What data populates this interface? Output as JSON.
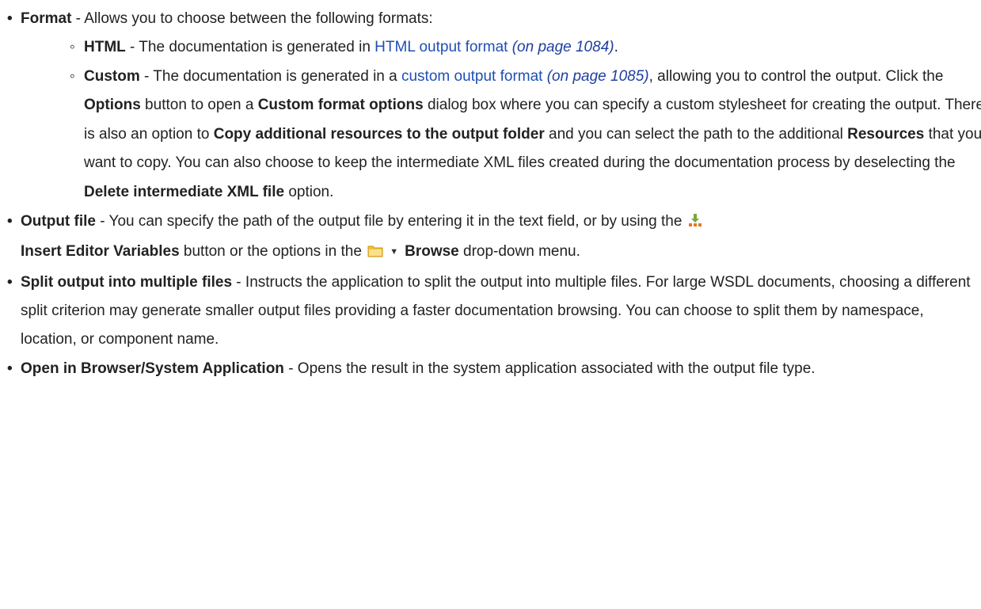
{
  "items": {
    "format": {
      "term": "Format",
      "text": " - Allows you to choose between the following formats:",
      "html": {
        "term": "HTML",
        "text": " - The documentation is generated in ",
        "link": "HTML output format",
        "ref": "(on page 1084)",
        "end": "."
      },
      "custom": {
        "term": "Custom",
        "text1": " - The documentation is generated in a ",
        "link": "custom output format",
        "ref": "(on page 1085)",
        "text2": ", allowing you to control the output. Click the ",
        "options": "Options",
        "text3": " button to open a ",
        "dialog": "Custom format options",
        "text4": " dialog box where you can specify a custom stylesheet for creating the output. There is also an option to ",
        "copy": "Copy additional resources to the output folder",
        "text5": " and you can select the path to the additional ",
        "resources": "Resources",
        "text6": " that you want to copy. You can also choose to keep the intermediate XML files created during the documentation process by deselecting the ",
        "delete": "Delete intermediate XML file",
        "text7": " option."
      }
    },
    "output_file": {
      "term": "Output file",
      "text1": " - You can specify the path of the output file by entering it in the text field, or by using the ",
      "insert": "Insert Editor Variables",
      "text2": " button or the options in the ",
      "browse": "Browse",
      "text3": " drop-down menu."
    },
    "split": {
      "term": "Split output into multiple files",
      "text": " - Instructs the application to split the output into multiple files. For large WSDL documents, choosing a different split criterion may generate smaller output files providing a faster documentation browsing. You can choose to split them by namespace, location, or component name."
    },
    "open": {
      "term": "Open in Browser/System Application",
      "text": " - Opens the result in the system application associated with the output file type."
    }
  },
  "icons": {
    "insert_variables": "insert-editor-variables-icon",
    "browse_folder": "folder-icon",
    "dropdown": "dropdown-arrow-icon"
  },
  "colors": {
    "link": "#1f4fb4",
    "text": "#222222",
    "folder": "#f2c230",
    "insert_icon": "#7aa73a"
  }
}
